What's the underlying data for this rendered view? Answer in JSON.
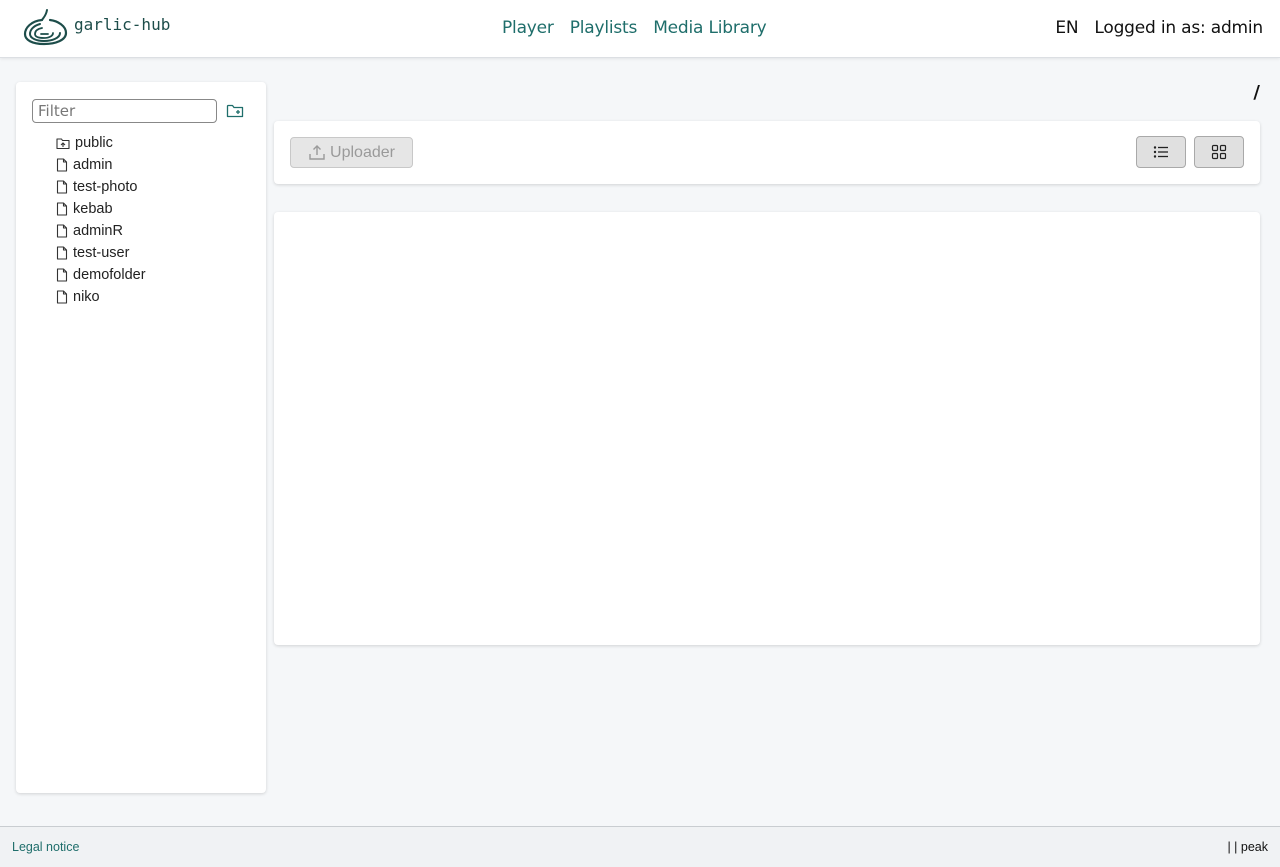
{
  "header": {
    "logo_text": "garlic-hub",
    "nav": [
      {
        "label": "Player"
      },
      {
        "label": "Playlists"
      },
      {
        "label": "Media Library"
      }
    ],
    "language": "EN",
    "logged_in": "Logged in as: admin"
  },
  "sidebar": {
    "filter_placeholder": "Filter",
    "items": [
      {
        "label": "public",
        "icon": "folder-open-icon"
      },
      {
        "label": "admin",
        "icon": "file-icon"
      },
      {
        "label": "test-photo",
        "icon": "file-icon"
      },
      {
        "label": "kebab",
        "icon": "file-icon"
      },
      {
        "label": "adminR",
        "icon": "file-icon"
      },
      {
        "label": "test-user",
        "icon": "file-icon"
      },
      {
        "label": "demofolder",
        "icon": "file-icon"
      },
      {
        "label": "niko",
        "icon": "file-icon"
      }
    ]
  },
  "breadcrumb": "/",
  "toolbar": {
    "uploader_label": "Uploader"
  },
  "footer": {
    "legal": "Legal notice",
    "right": "| | peak"
  },
  "colors": {
    "accent": "#1f6e6b",
    "background": "#f5f7f9",
    "panel": "#ffffff"
  }
}
